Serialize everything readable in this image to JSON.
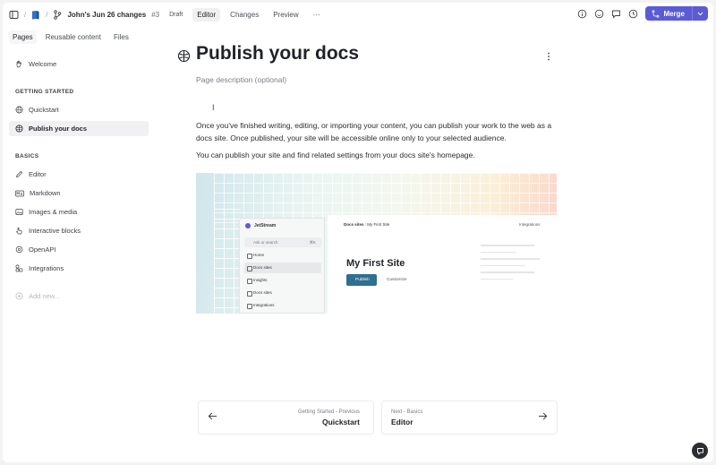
{
  "topbar": {
    "change_request_title": "John's Jun 26 changes",
    "change_request_number": "#3",
    "status": "Draft",
    "tabs": [
      "Editor",
      "Changes",
      "Preview"
    ],
    "more": "···",
    "merge_label": "Merge"
  },
  "sidebar": {
    "tabs": [
      "Pages",
      "Reusable content",
      "Files"
    ],
    "welcome": "Welcome",
    "section_getting_started": "GETTING STARTED",
    "quickstart": "Quickstart",
    "publish_your_docs": "Publish your docs",
    "section_basics": "BASICS",
    "editor": "Editor",
    "markdown": "Markdown",
    "images_media": "Images & media",
    "interactive_blocks": "Interactive blocks",
    "openapi": "OpenAPI",
    "integrations": "Integrations",
    "add_new": "Add new..."
  },
  "main": {
    "title": "Publish your docs",
    "description_placeholder": "Page description (optional)",
    "paragraph1": "Once you've finished writing, editing, or importing your content, you can publish your work to the web as a docs site. Once published, your site will be accessible online only to your selected audience.",
    "paragraph2": "You can publish your site and find related settings from your docs site's homepage.",
    "hero": {
      "brand": "JetStream",
      "search": "Ask or search",
      "shortcut": "⌘K",
      "items": [
        "Home",
        "Docs sites",
        "Insights",
        "Docs sites",
        "Integrations"
      ],
      "crumb_root": "Docs sites",
      "crumb_page": "My First Site",
      "integrations": "Integrations",
      "site_title": "My First Site",
      "publish": "Publish",
      "customize": "Customize"
    },
    "prev": {
      "sub": "Getting Started - Previous",
      "title": "Quickstart"
    },
    "next": {
      "sub": "Next - Basics",
      "title": "Editor"
    }
  },
  "colors": {
    "accent": "#5b5bd6",
    "publish_button": "#2f6f8f"
  }
}
